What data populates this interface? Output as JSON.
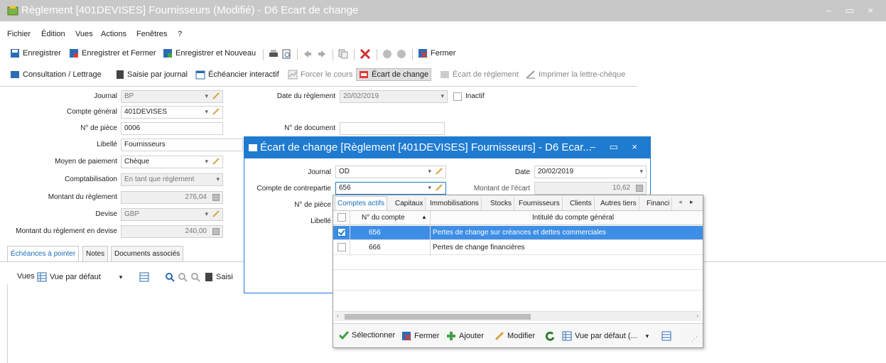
{
  "window": {
    "title": "Règlement [401DEVISES] Fournisseurs (Modifié) - D6 Ecart de change",
    "controls": "– ▭ ×"
  },
  "menu": [
    "Fichier",
    "Édition",
    "Vues",
    "Actions",
    "Fenêtres",
    "?"
  ],
  "toolbar1": {
    "save": "Enregistrer",
    "save_close": "Enregistrer et Fermer",
    "save_new": "Enregistrer et Nouveau",
    "close": "Fermer"
  },
  "toolbar2": {
    "consultation": "Consultation / Lettrage",
    "saisie": "Saisie par journal",
    "echeancier": "Échéancier interactif",
    "forcer": "Forcer le cours",
    "ecart_change": "Écart de change",
    "ecart_reglement": "Écart de règlement",
    "imprimer": "Imprimer la lettre-chèque"
  },
  "form": {
    "journal_label": "Journal",
    "journal_value": "BP",
    "compte_label": "Compte général",
    "compte_value": "401DEVISES",
    "piece_label": "N° de pièce",
    "piece_value": "0006",
    "libelle_label": "Libellé",
    "libelle_value": "Fournisseurs",
    "moyen_label": "Moyen de paiement",
    "moyen_value": "Chèque",
    "compta_label": "Comptabilisation",
    "compta_value": "En tant que règlement",
    "montant_label": "Montant du règlement",
    "montant_value": "276,04",
    "devise_label": "Devise",
    "devise_value": "GBP",
    "montant_devise_label": "Montant du règlement en devise",
    "montant_devise_value": "240,00",
    "date_label": "Date du règlement",
    "date_value": "20/02/2019",
    "inactif_label": "Inactif",
    "document_label": "N° de document",
    "document_value": ""
  },
  "lower_tabs": [
    "Échéances à pointer",
    "Notes",
    "Documents associés"
  ],
  "lower_toolbar": {
    "vues_label": "Vues",
    "vue_value": "Vue par défaut",
    "saisie_partial": "Saisi"
  },
  "dialog": {
    "title": "Écart de change [Règlement [401DEVISES] Fournisseurs] - D6 Ecar...",
    "controls": "– ▭ ×",
    "journal_label": "Journal",
    "journal_value": "OD",
    "date_label": "Date",
    "date_value": "20/02/2019",
    "contrepartie_label": "Compte de contrepartie",
    "contrepartie_value": "656",
    "montant_label": "Montant de l'écart",
    "montant_value": "10,62",
    "piece_label": "N° de pièce",
    "libelle_label": "Libellé"
  },
  "popup": {
    "tabs": [
      "Comptes actifs",
      "Capitaux",
      "Immobilisations",
      "Stocks",
      "Fournisseurs",
      "Clients",
      "Autres tiers",
      "Financi"
    ],
    "col_compte": "N° du compte",
    "col_intitule": "Intitulé du compte général",
    "rows": [
      {
        "compte": "656",
        "intitule": "Pertes de change sur créances et dettes commerciales",
        "checked": true
      },
      {
        "compte": "666",
        "intitule": "Pertes de change financières",
        "checked": false
      }
    ],
    "footer": {
      "select": "Sélectionner",
      "close": "Fermer",
      "add": "Ajouter",
      "modify": "Modifier",
      "view": "Vue par défaut (..."
    }
  },
  "colors": {
    "accent": "#1e7bd0",
    "selected_row": "#3d8ee6"
  }
}
